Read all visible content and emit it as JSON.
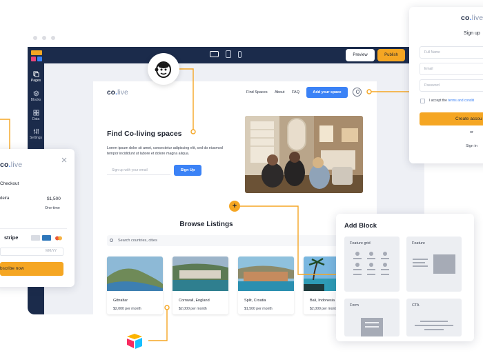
{
  "builder": {
    "preview_label": "Preview",
    "publish_label": "Publish",
    "sidebar": [
      {
        "label": "Pages",
        "icon": "pages-icon"
      },
      {
        "label": "Blocks",
        "icon": "blocks-icon"
      },
      {
        "label": "Data",
        "icon": "data-icon"
      },
      {
        "label": "Settings",
        "icon": "settings-icon"
      }
    ],
    "devices": [
      "desktop-icon",
      "tablet-icon",
      "phone-icon"
    ],
    "colors": {
      "navy": "#1b2b4b",
      "accent": "#f5a623",
      "blue": "#3b82f6"
    }
  },
  "site": {
    "brand_main": "co",
    "brand_dot": ".",
    "brand_tail": "live",
    "nav": [
      "Find Spaces",
      "About",
      "FAQ"
    ],
    "add_space_label": "Add your space",
    "hero_title": "Find Co-living spaces",
    "hero_sub": "Lorem ipsum dolor sit amet, consectetur adipiscing elit, sed do eiusmod tempor incididunt ut labore et dolore magna aliqua.",
    "email_placeholder": "Sign up with your email",
    "signup_label": "Sign Up",
    "browse_title": "Browse Listings",
    "search_placeholder": "Search countries, cities",
    "listings": [
      {
        "name": "Gibraltar",
        "price": "$2,000 per month"
      },
      {
        "name": "Cornwall, England",
        "price": "$2,000 per month"
      },
      {
        "name": "Split, Croatia",
        "price": "$1,500 per month"
      },
      {
        "name": "Bali, Indonesia",
        "price": "$2,000 per month"
      }
    ]
  },
  "signup_panel": {
    "brand_main": "co",
    "brand_dot": ".",
    "brand_tail": "live",
    "title": "Sign up",
    "full_name_placeholder": "Full Name",
    "email_placeholder": "Email",
    "password_placeholder": "Password",
    "terms_prefix": "I accept the ",
    "terms_link": "terms and conditi",
    "create_label": "Create accou",
    "or_label": "or",
    "signin_label": "Sign in"
  },
  "checkout_panel": {
    "brand_main": "co",
    "brand_dot": ".",
    "brand_tail": "live",
    "title": "Checkout",
    "item": "deira",
    "price": "$1,500",
    "term": "One-time",
    "stripe_label": "stripe",
    "card_exp_placeholder": "MM/YY",
    "subscribe_label": "bscribe now"
  },
  "add_block": {
    "title": "Add Block",
    "blocks": [
      "Feature grid",
      "Feature",
      "Form",
      "CTA"
    ]
  }
}
